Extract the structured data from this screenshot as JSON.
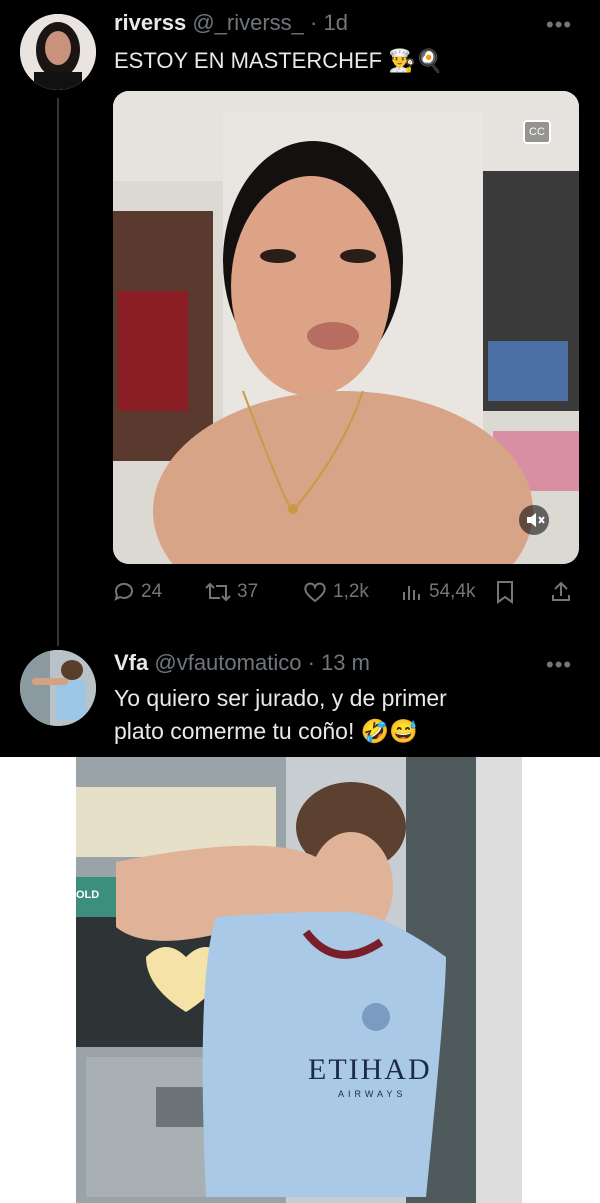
{
  "tweet1": {
    "name": "riverss",
    "handle": "@_riverss_",
    "time": "· 1d",
    "text": "ESTOY EN MASTERCHEF",
    "emojis": "👨‍🍳🍳",
    "video_icons": {
      "captions": "captions-icon",
      "mute": "mute-icon"
    },
    "stats": {
      "replies": "24",
      "reposts": "37",
      "likes": "1,2k",
      "views": "54,4k"
    },
    "icons": [
      "reply-icon",
      "repost-icon",
      "like-icon",
      "views-icon",
      "bookmark-icon",
      "share-icon",
      "more-icon"
    ]
  },
  "tweet2": {
    "name": "Vfa",
    "handle": "@vfautomatico",
    "time": "· 13 m",
    "text_line1": "Yo quiero ser jurado, y de primer",
    "text_line2": "plato comerme tu coño!",
    "emojis": "🤣😅"
  },
  "bottom_photo": {
    "shirt_sponsor": "ETIHAD",
    "shirt_sponsor_sub": "AIRWAYS",
    "sign_text": "OLD"
  },
  "colors": {
    "background": "#000000",
    "text": "#e7e9ea",
    "muted": "#71767b",
    "divider": "#333639"
  }
}
